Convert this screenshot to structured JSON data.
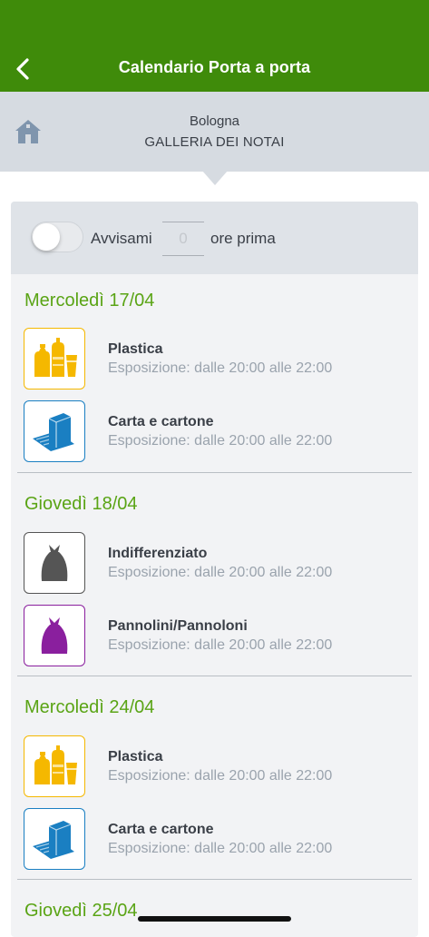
{
  "header": {
    "title": "Calendario Porta a porta"
  },
  "location": {
    "city": "Bologna",
    "street": "GALLERIA DEI NOTAI"
  },
  "notify": {
    "label": "Avvisami",
    "hours_placeholder": "0",
    "suffix": "ore prima",
    "enabled": false
  },
  "days": [
    {
      "date": "Mercoledì 17/04",
      "items": [
        {
          "name": "Plastica",
          "time": "Esposizione: dalle 20:00 alle 22:00"
        },
        {
          "name": "Carta e cartone",
          "time": "Esposizione: dalle 20:00 alle 22:00"
        }
      ]
    },
    {
      "date": "Giovedì 18/04",
      "items": [
        {
          "name": "Indifferenziato",
          "time": "Esposizione: dalle 20:00 alle 22:00"
        },
        {
          "name": "Pannolini/Pannoloni",
          "time": "Esposizione: dalle 20:00 alle 22:00"
        }
      ]
    },
    {
      "date": "Mercoledì 24/04",
      "items": [
        {
          "name": "Plastica",
          "time": "Esposizione: dalle 20:00 alle 22:00"
        },
        {
          "name": "Carta e cartone",
          "time": "Esposizione: dalle 20:00 alle 22:00"
        }
      ]
    },
    {
      "date": "Giovedì 25/04",
      "items": []
    }
  ],
  "colors": {
    "header": "#3f8b0a",
    "day_title": "#5aa415",
    "plastica": "#f5b800",
    "carta": "#1a7fc2",
    "indifferenziato": "#555555",
    "pannolini": "#8a1f9e"
  }
}
